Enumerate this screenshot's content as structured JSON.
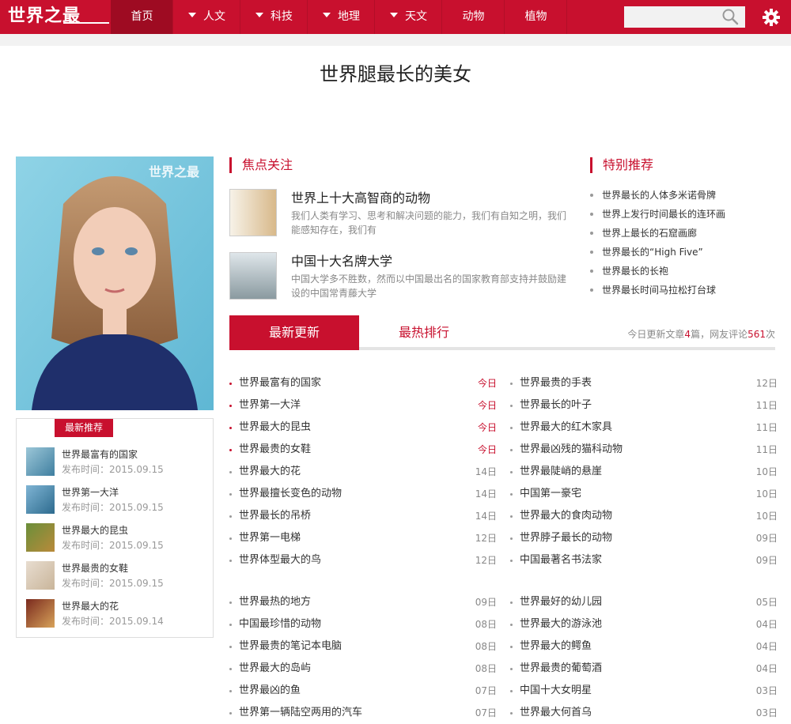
{
  "site": {
    "logo": "世界之最"
  },
  "nav": [
    {
      "label": "首页",
      "dropdown": false,
      "active": true
    },
    {
      "label": "人文",
      "dropdown": true,
      "active": false
    },
    {
      "label": "科技",
      "dropdown": true,
      "active": false
    },
    {
      "label": "地理",
      "dropdown": true,
      "active": false
    },
    {
      "label": "天文",
      "dropdown": true,
      "active": false
    },
    {
      "label": "动物",
      "dropdown": false,
      "active": false
    },
    {
      "label": "植物",
      "dropdown": false,
      "active": false
    }
  ],
  "search": {
    "placeholder": ""
  },
  "page": {
    "title": "世界腿最长的美女"
  },
  "hero": {
    "watermark": "世界之最"
  },
  "latest": {
    "tag": "最新推荐",
    "items": [
      {
        "title": "世界最富有的国家",
        "date": "发布时间：2015.09.15"
      },
      {
        "title": "世界第一大洋",
        "date": "发布时间：2015.09.15"
      },
      {
        "title": "世界最大的昆虫",
        "date": "发布时间：2015.09.15"
      },
      {
        "title": "世界最贵的女鞋",
        "date": "发布时间：2015.09.15"
      },
      {
        "title": "世界最大的花",
        "date": "发布时间：2015.09.14"
      }
    ]
  },
  "focus": {
    "heading": "焦点关注",
    "items": [
      {
        "title": "世界上十大高智商的动物",
        "desc": "我们人类有学习、思考和解决问题的能力，我们有自知之明，我们能感知存在，我们有"
      },
      {
        "title": "中国十大名牌大学",
        "desc": "中国大学多不胜数，然而以中国最出名的国家教育部支持并鼓励建设的中国常青藤大学"
      }
    ]
  },
  "special": {
    "heading": "特别推荐",
    "items": [
      "世界最长的人体多米诺骨牌",
      "世界上发行时间最长的连环画",
      "世界上最长的石窟画廊",
      "世界最长的“High Five”",
      "世界最长的长袍",
      "世界最长时间马拉松打台球"
    ]
  },
  "tabs": {
    "active": "最新更新",
    "inactive": "最热排行",
    "stats": {
      "prefix": "今日更新文章",
      "count": "4",
      "mid": "篇，网友评论",
      "comments": "561",
      "suffix": "次"
    }
  },
  "articles": {
    "left_top": [
      {
        "title": "世界最富有的国家",
        "date": "今日",
        "hot": true
      },
      {
        "title": "世界第一大洋",
        "date": "今日",
        "hot": true
      },
      {
        "title": "世界最大的昆虫",
        "date": "今日",
        "hot": true
      },
      {
        "title": "世界最贵的女鞋",
        "date": "今日",
        "hot": true
      },
      {
        "title": "世界最大的花",
        "date": "14日",
        "hot": false
      },
      {
        "title": "世界最擅长变色的动物",
        "date": "14日",
        "hot": false
      },
      {
        "title": "世界最长的吊桥",
        "date": "14日",
        "hot": false
      },
      {
        "title": "世界第一电梯",
        "date": "12日",
        "hot": false
      },
      {
        "title": "世界体型最大的鸟",
        "date": "12日",
        "hot": false
      }
    ],
    "right_top": [
      {
        "title": "世界最贵的手表",
        "date": "12日"
      },
      {
        "title": "世界最长的叶子",
        "date": "11日"
      },
      {
        "title": "世界最大的红木家具",
        "date": "11日"
      },
      {
        "title": "世界最凶残的猫科动物",
        "date": "11日"
      },
      {
        "title": "世界最陡峭的悬崖",
        "date": "10日"
      },
      {
        "title": "中国第一豪宅",
        "date": "10日"
      },
      {
        "title": "世界最大的食肉动物",
        "date": "10日"
      },
      {
        "title": "世界脖子最长的动物",
        "date": "09日"
      },
      {
        "title": "中国最著名书法家",
        "date": "09日"
      }
    ],
    "left_bottom": [
      {
        "title": "世界最热的地方",
        "date": "09日"
      },
      {
        "title": "中国最珍惜的动物",
        "date": "08日"
      },
      {
        "title": "世界最贵的笔记本电脑",
        "date": "08日"
      },
      {
        "title": "世界最大的岛屿",
        "date": "08日"
      },
      {
        "title": "世界最凶的鱼",
        "date": "07日"
      },
      {
        "title": "世界第一辆陆空两用的汽车",
        "date": "07日"
      }
    ],
    "right_bottom": [
      {
        "title": "世界最好的幼儿园",
        "date": "05日"
      },
      {
        "title": "世界最大的游泳池",
        "date": "04日"
      },
      {
        "title": "世界最大的鳄鱼",
        "date": "04日"
      },
      {
        "title": "世界最贵的葡萄酒",
        "date": "04日"
      },
      {
        "title": "中国十大女明星",
        "date": "03日"
      },
      {
        "title": "世界最大何首乌",
        "date": "03日"
      }
    ]
  },
  "colors": {
    "brand": "#c8102e",
    "nav_active": "#9e0b22"
  }
}
